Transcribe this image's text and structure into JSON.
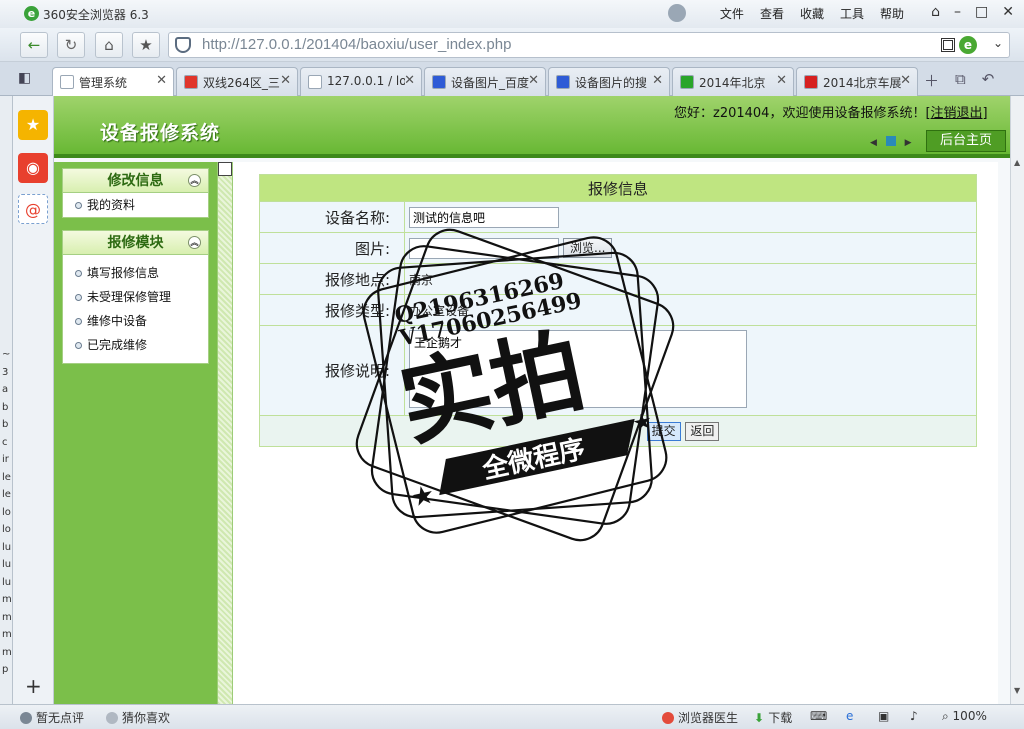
{
  "browser": {
    "app_title": "360安全浏览器 6.3",
    "logo_letter": "e",
    "menu": [
      "文件",
      "查看",
      "收藏",
      "工具",
      "帮助"
    ],
    "url": "http://127.0.0.1/201404/baoxiu/user_index.php",
    "tabs": [
      {
        "label": "管理系统",
        "icon_color": "#ffffff",
        "active": true
      },
      {
        "label": "双线264区_三",
        "icon_color": "#e0352b"
      },
      {
        "label": "127.0.0.1 / lo",
        "icon_color": "#ffffff"
      },
      {
        "label": "设备图片_百度",
        "icon_color": "#2e5bd6"
      },
      {
        "label": "设备图片的搜",
        "icon_color": "#2e5bd6"
      },
      {
        "label": "2014年北京",
        "icon_color": "#2aa52a"
      },
      {
        "label": "2014北京车展",
        "icon_color": "#d62020"
      }
    ],
    "dock_letters": [
      "~",
      "3",
      "a",
      "b",
      "b",
      "c",
      "ir",
      "le",
      "le",
      "lo",
      "lo",
      "lu",
      "lu",
      "lu",
      "m",
      "m",
      "m",
      "m",
      "p"
    ],
    "statusbar": {
      "rating": "暂无点评",
      "guess": "猜你喜欢",
      "doctor": "浏览器医生",
      "download": "下载",
      "zoom": "100%"
    },
    "accent_color": "#3aa23a"
  },
  "page": {
    "system_title": "设备报修系统",
    "welcome_prefix": "您好：z201404，欢迎使用设备报修系统！[",
    "logout_label": "注销退出",
    "welcome_suffix": "]",
    "home_button": "后台主页",
    "menu": [
      {
        "title": "修改信息",
        "items": [
          "我的资料"
        ]
      },
      {
        "title": "报修模块",
        "items": [
          "填写报修信息",
          "未受理保修管理",
          "维修中设备",
          "已完成维修"
        ]
      }
    ],
    "form": {
      "title": "报修信息",
      "name_label": "设备名称:",
      "name_value": "测试的信息吧",
      "image_label": "图片:",
      "browse_label": "浏览...",
      "location_label": "报修地点:",
      "location_value": "南京",
      "type_label": "报修类型:",
      "type_value": "办公室设备",
      "desc_label": "报修说明:",
      "desc_value": "王企鹅才",
      "submit_label": "提交",
      "back_label": "返回"
    },
    "header_color": "#68b834",
    "menu_bg_color": "#7bbf4a"
  },
  "watermark": {
    "line1": "Q2196316269",
    "line2": "V17060256499",
    "main": "实拍",
    "banner": "全微程序"
  }
}
